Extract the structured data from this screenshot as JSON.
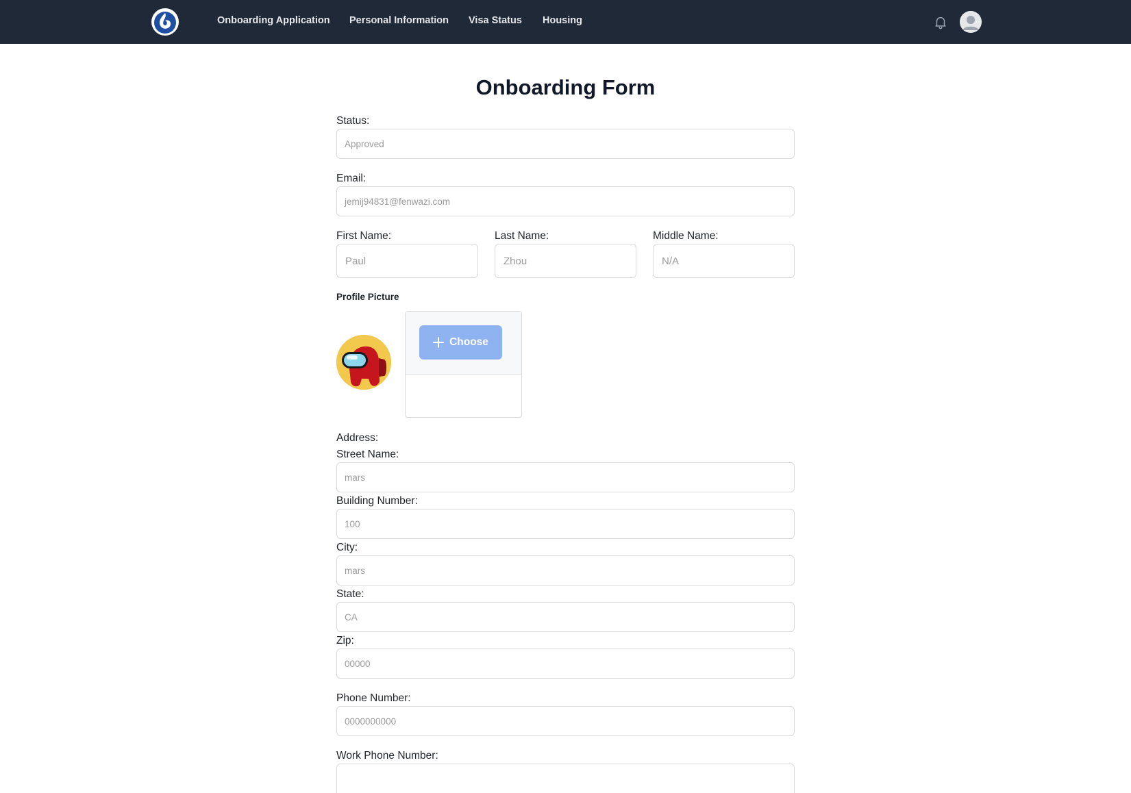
{
  "nav": {
    "links": [
      "Onboarding Application",
      "Personal Information",
      "Visa Status",
      "Housing"
    ]
  },
  "page": {
    "title": "Onboarding Form"
  },
  "form": {
    "status": {
      "label": "Status:",
      "value": "Approved"
    },
    "email": {
      "label": "Email:",
      "value": "jemij94831@fenwazi.com"
    },
    "first_name": {
      "label": "First Name:",
      "value": "Paul"
    },
    "last_name": {
      "label": "Last Name:",
      "value": "Zhou"
    },
    "middle_name": {
      "label": "Middle Name:",
      "value": "N/A"
    },
    "profile_picture": {
      "label": "Profile Picture",
      "choose_label": "Choose"
    },
    "address": {
      "label": "Address:",
      "street": {
        "label": "Street Name:",
        "value": "mars"
      },
      "building": {
        "label": "Building Number:",
        "value": "100"
      },
      "city": {
        "label": "City:",
        "value": "mars"
      },
      "state": {
        "label": "State:",
        "value": "CA"
      },
      "zip": {
        "label": "Zip:",
        "value": "00000"
      }
    },
    "phone": {
      "label": "Phone Number:",
      "value": "0000000000"
    },
    "work_phone": {
      "label": "Work Phone Number:",
      "value": ""
    }
  },
  "icons": {
    "logo": "company-logo-icon",
    "notifications": "bell-icon",
    "user": "user-avatar-icon",
    "upload": "plus-icon"
  },
  "colors": {
    "navbar": "#1f2937",
    "primary_button": "#8fb3f0",
    "logo_blue": "#1e4fa3"
  }
}
